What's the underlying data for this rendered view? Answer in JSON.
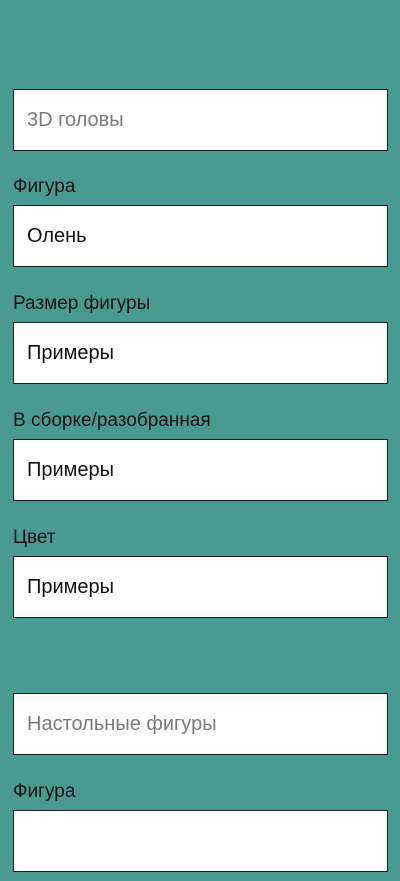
{
  "section1": {
    "category_placeholder": "3D головы",
    "fields": [
      {
        "label": "Фигура",
        "value": "Олень"
      },
      {
        "label": "Размер фигуры",
        "value": "Примеры"
      },
      {
        "label": "В сборке/разобранная",
        "value": "Примеры"
      },
      {
        "label": "Цвет",
        "value": "Примеры"
      }
    ]
  },
  "section2": {
    "category_placeholder": "Настольные фигуры",
    "fields": [
      {
        "label": "Фигура",
        "value": ""
      }
    ]
  },
  "colors": {
    "background": "#4a9a94",
    "field_background": "#ffffff",
    "field_border": "#1a1a1a",
    "placeholder_text": "#7b7b7b"
  }
}
